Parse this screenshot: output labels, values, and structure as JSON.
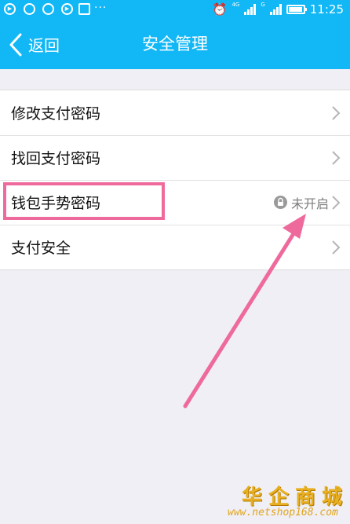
{
  "status_bar": {
    "icons": [
      "play-icon",
      "app-icon",
      "app-icon",
      "play-icon",
      "image-icon"
    ],
    "overflow": "···",
    "network": "4G",
    "network2": "G",
    "battery_level": 0.85,
    "time": "11:25"
  },
  "nav": {
    "back_label": "返回",
    "title": "安全管理"
  },
  "list": {
    "items": [
      {
        "label": "修改支付密码"
      },
      {
        "label": "找回支付密码"
      },
      {
        "label": "钱包手势密码",
        "status": "未开启",
        "lock_icon": "lock-icon"
      },
      {
        "label": "支付安全"
      }
    ]
  },
  "watermark": {
    "logo_text": "华企商城",
    "url": "www.netshop168.com"
  },
  "colors": {
    "header_bg": "#12b7f5",
    "page_bg": "#f0eff5",
    "highlight": "#ef6a9c",
    "chevron": "#b5b5b5",
    "status_text": "#7d7d7d"
  }
}
